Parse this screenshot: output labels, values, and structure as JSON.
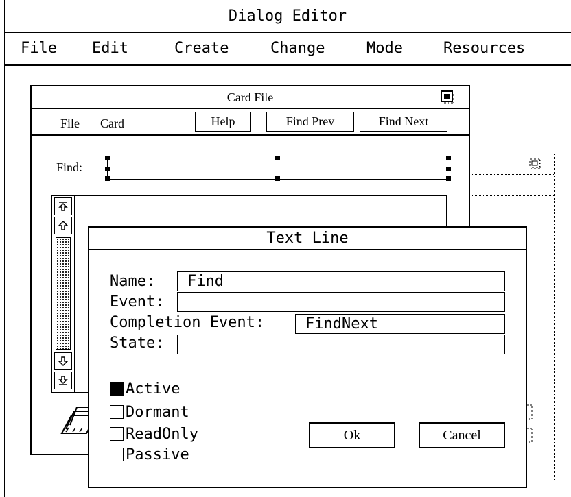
{
  "app": {
    "title": "Dialog Editor",
    "menu": [
      "File",
      "Edit",
      "Create",
      "Change",
      "Mode",
      "Resources"
    ]
  },
  "card_file": {
    "title": "Card File",
    "menu": [
      "File",
      "Card"
    ],
    "buttons": {
      "help": "Help",
      "find_prev": "Find Prev",
      "find_next": "Find Next"
    },
    "find_label": "Find:",
    "find_value": ""
  },
  "text_line_dialog": {
    "title": "Text Line",
    "fields": {
      "name": {
        "label": "Name:",
        "value": "Find"
      },
      "event": {
        "label": "Event:",
        "value": ""
      },
      "completion_event": {
        "label": "Completion Event:",
        "value": "FindNext"
      },
      "state": {
        "label": "State:",
        "value": ""
      }
    },
    "options": [
      {
        "label": "Active",
        "checked": true
      },
      {
        "label": "Dormant",
        "checked": false
      },
      {
        "label": "ReadOnly",
        "checked": false
      },
      {
        "label": "Passive",
        "checked": false
      }
    ],
    "ok_label": "Ok",
    "cancel_label": "Cancel"
  },
  "icons": {
    "card_file_max": "maximize-icon",
    "scroll_top": "scroll-to-top-icon",
    "scroll_up": "arrow-up-icon",
    "scroll_down": "arrow-down-icon",
    "scroll_bottom": "scroll-to-bottom-icon",
    "card_file_app": "card-file-icon"
  }
}
